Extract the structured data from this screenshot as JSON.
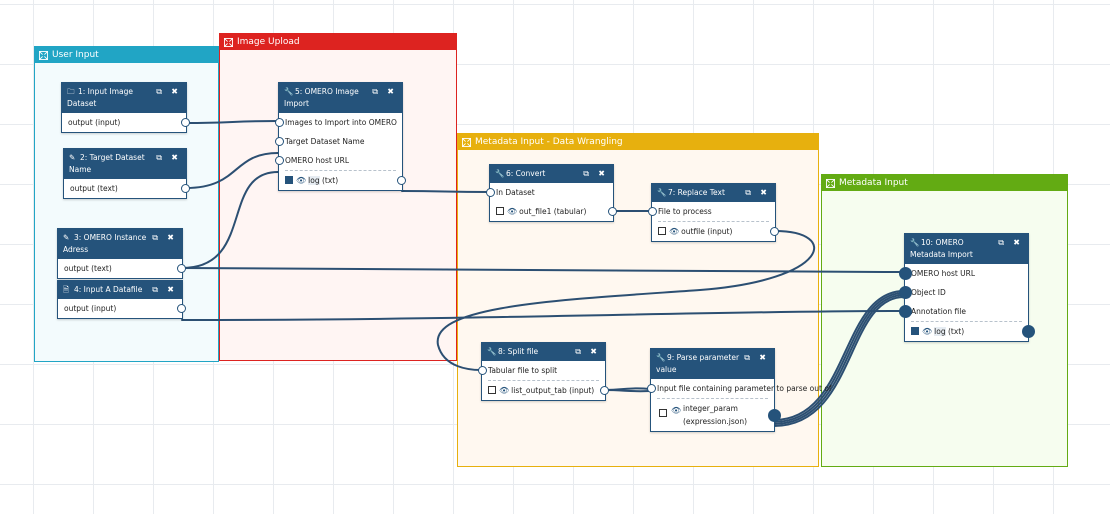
{
  "frames": {
    "user_input": {
      "title": "User Input",
      "color": "#21a5c5",
      "bg": "#f3fbfd"
    },
    "image_upload": {
      "title": "Image Upload",
      "color": "#dd2320",
      "bg": "#fff5f3"
    },
    "metadata_wrangling": {
      "title": "Metadata Input - Data Wrangling",
      "color": "#e7b00e",
      "bg": "#fff8f0"
    },
    "metadata_input": {
      "title": "Metadata Input",
      "color": "#63ab13",
      "bg": "#f6fdef"
    }
  },
  "nodes": {
    "n1": {
      "title": "1: Input Image Dataset",
      "icon": "folder-icon",
      "outputs": [
        "output (input)"
      ]
    },
    "n2": {
      "title": "2: Target Dataset Name",
      "icon": "pencil-icon",
      "outputs": [
        "output (text)"
      ]
    },
    "n3": {
      "title": "3: OMERO Instance Adress",
      "icon": "pencil-icon",
      "outputs": [
        "output (text)"
      ]
    },
    "n4": {
      "title": "4: Input A Datafile",
      "icon": "file-icon",
      "outputs": [
        "output (input)"
      ]
    },
    "n5": {
      "title": "5: OMERO Image Import",
      "icon": "wrench-icon",
      "inputs": [
        "Images to Import into OMERO",
        "Target Dataset Name",
        "OMERO host URL"
      ],
      "outputs": [
        "log",
        " (txt)"
      ]
    },
    "n6": {
      "title": "6: Convert",
      "icon": "wrench-icon",
      "inputs": [
        "In Dataset"
      ],
      "outputs": [
        "out_file1 (tabular)"
      ]
    },
    "n7": {
      "title": "7: Replace Text",
      "icon": "wrench-icon",
      "inputs": [
        "File to process"
      ],
      "outputs": [
        "outfile (input)"
      ]
    },
    "n8": {
      "title": "8: Split file",
      "icon": "wrench-icon",
      "inputs": [
        "Tabular file to split"
      ],
      "outputs": [
        "list_output_tab (input)"
      ]
    },
    "n9": {
      "title": "9: Parse parameter value",
      "icon": "wrench-icon",
      "inputs": [
        "Input file containing parameter to parse out of"
      ],
      "outputs": [
        "integer_param (expression.json)"
      ]
    },
    "n10": {
      "title": "10: OMERO Metadata Import",
      "icon": "wrench-icon",
      "inputs": [
        "OMERO host URL",
        "Object ID",
        "Annotation file"
      ],
      "outputs": [
        "log",
        " (txt)"
      ]
    }
  },
  "wire_color": "#2c4f72"
}
